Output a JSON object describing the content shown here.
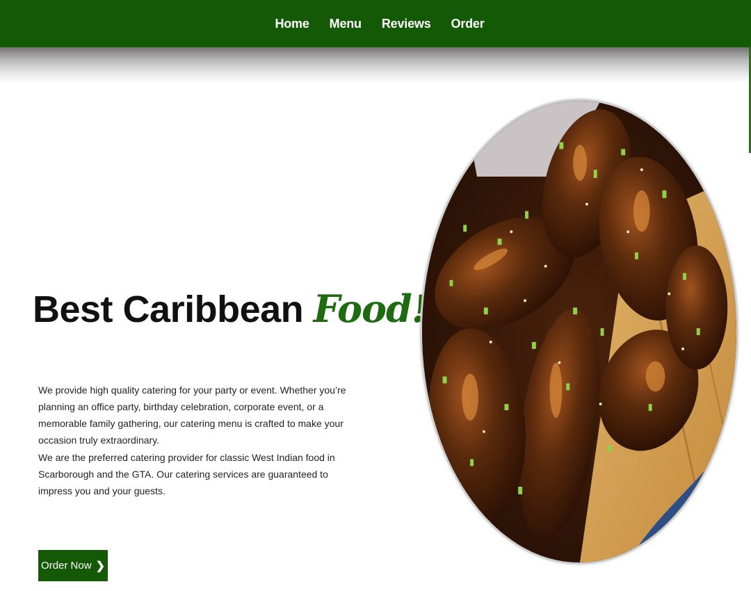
{
  "nav": {
    "items": [
      {
        "label": "Home"
      },
      {
        "label": "Menu"
      },
      {
        "label": "Reviews"
      },
      {
        "label": "Order"
      }
    ]
  },
  "hero": {
    "headline_main": "Best Caribbean",
    "headline_accent": "Food!",
    "paragraph_1": "We provide high quality catering for your party or event. Whether you’re planning an office party, birthday celebration, corporate event, or a memorable family gathering, our catering menu is crafted to make your occasion truly extraordinary.",
    "paragraph_2": "We are the preferred catering provider for classic West Indian food in Scarborough and the GTA. Our catering services are guaranteed to impress you and your guests.",
    "cta_label": "Order Now",
    "cta_icon": "chevron-right-icon"
  },
  "colors": {
    "brand_green": "#145a06",
    "accent_green": "#1f6b12",
    "text_dark": "#111111"
  }
}
